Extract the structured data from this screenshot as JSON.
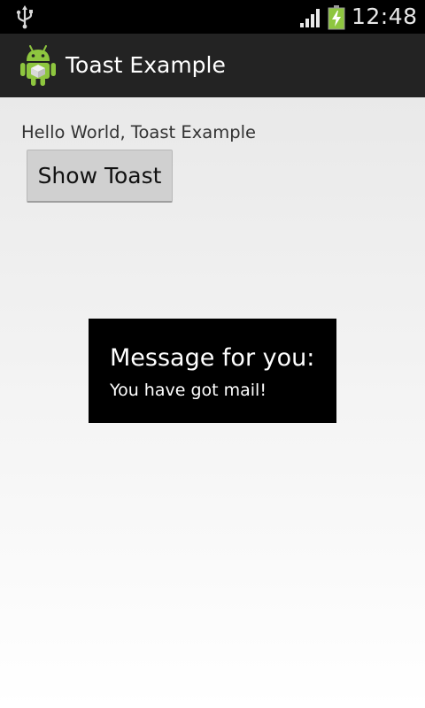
{
  "status_bar": {
    "usb_icon": "usb-icon",
    "signal_icon": "signal-icon",
    "battery_icon": "battery-charging-icon",
    "time": "12:48",
    "accent_color": "#8ec63f"
  },
  "action_bar": {
    "app_icon": "android-robot-icon",
    "title": "Toast Example"
  },
  "main": {
    "hello_text": "Hello World, Toast Example",
    "show_toast_label": "Show Toast"
  },
  "toast": {
    "title": "Message for you:",
    "message": "You have got mail!"
  }
}
